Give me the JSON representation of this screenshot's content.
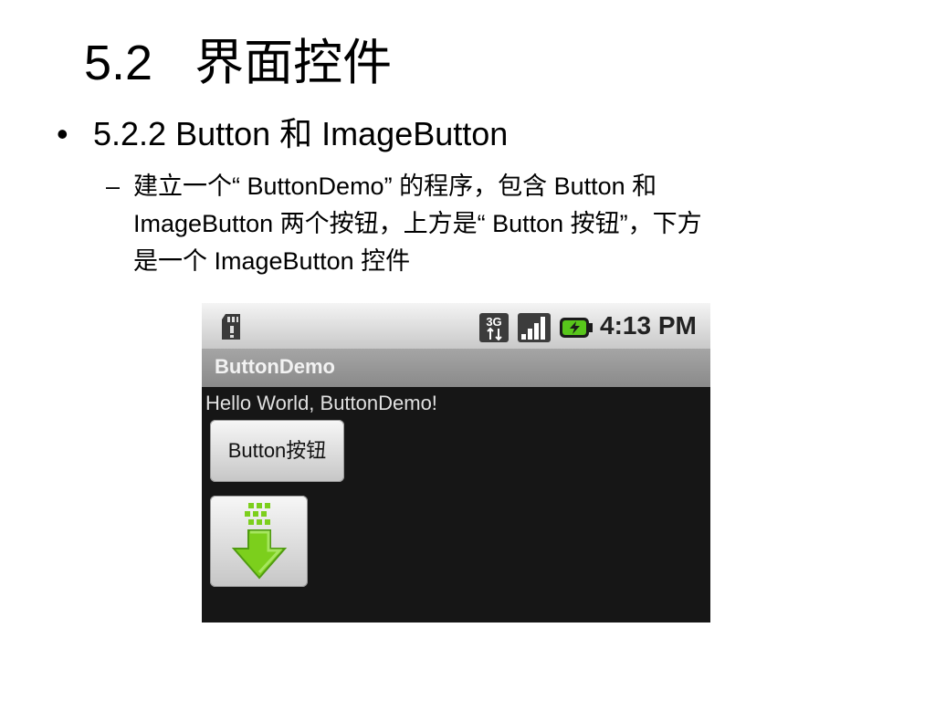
{
  "slide": {
    "title_number": "5.2",
    "title_text": "界面控件",
    "bullet1_marker": "•",
    "bullet1": "5.2.2 Button 和 ImageButton",
    "bullet2_marker": "–",
    "bullet2_lines": [
      "建立一个“ ButtonDemo” 的程序，包含 Button 和",
      "ImageButton 两个按钮，上方是“ Button 按钮”，下方",
      "是一个 ImageButton 控件"
    ]
  },
  "phone": {
    "status_bar": {
      "time": "4:13 PM",
      "network_label": "3G",
      "icons": [
        "sd-card-icon",
        "3g-icon",
        "signal-icon",
        "battery-charging-icon"
      ]
    },
    "app_title": "ButtonDemo",
    "hello_text": "Hello World, ButtonDemo!",
    "button_label": "Button按钮",
    "image_button_icon": "download-arrow-icon",
    "colors": {
      "screen_bg": "#161616",
      "arrow_green": "#7ccf1c"
    }
  }
}
